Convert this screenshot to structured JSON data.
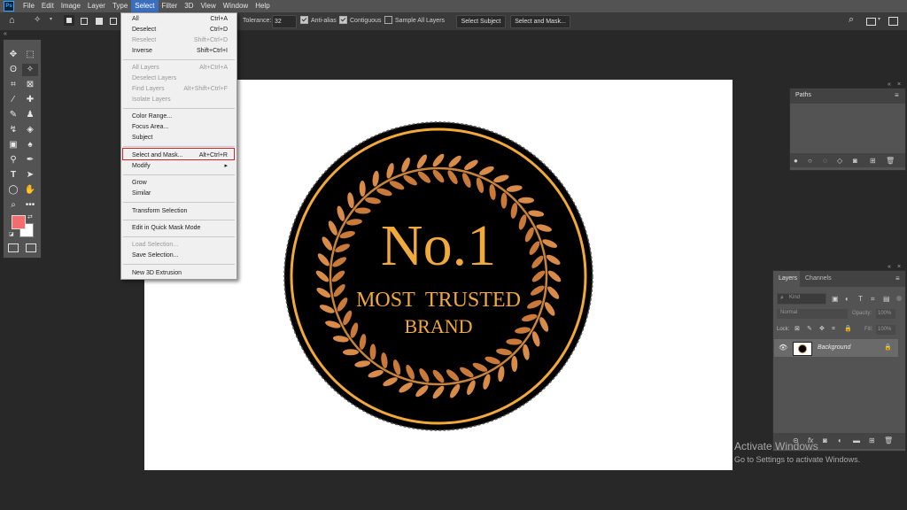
{
  "app": {
    "logo": "Ps"
  },
  "menubar": {
    "items": [
      "File",
      "Edit",
      "Image",
      "Layer",
      "Type",
      "Select",
      "Filter",
      "3D",
      "View",
      "Window",
      "Help"
    ],
    "active": "Select"
  },
  "options": {
    "tolerance_label": "Tolerance:",
    "tolerance_value": "32",
    "anti_alias": "Anti-alias",
    "contiguous": "Contiguous",
    "sample_all_layers": "Sample All Layers",
    "select_subject": "Select Subject",
    "select_and_mask": "Select and Mask..."
  },
  "select_menu": {
    "items": [
      {
        "label": "All",
        "shortcut": "Ctrl+A",
        "disabled": false
      },
      {
        "label": "Deselect",
        "shortcut": "Ctrl+D",
        "disabled": false
      },
      {
        "label": "Reselect",
        "shortcut": "Shift+Ctrl+D",
        "disabled": true
      },
      {
        "label": "Inverse",
        "shortcut": "Shift+Ctrl+I",
        "disabled": false
      },
      {
        "label": "All Layers",
        "shortcut": "Alt+Ctrl+A",
        "disabled": true
      },
      {
        "label": "Deselect Layers",
        "shortcut": "",
        "disabled": true
      },
      {
        "label": "Find Layers",
        "shortcut": "Alt+Shift+Ctrl+F",
        "disabled": true
      },
      {
        "label": "Isolate Layers",
        "shortcut": "",
        "disabled": true
      },
      {
        "label": "Color Range...",
        "shortcut": "",
        "disabled": false
      },
      {
        "label": "Focus Area...",
        "shortcut": "",
        "disabled": false
      },
      {
        "label": "Subject",
        "shortcut": "",
        "disabled": false
      },
      {
        "label": "Select and Mask...",
        "shortcut": "Alt+Ctrl+R",
        "disabled": false
      },
      {
        "label": "Modify",
        "shortcut": "▸",
        "disabled": false
      },
      {
        "label": "Grow",
        "shortcut": "",
        "disabled": false
      },
      {
        "label": "Similar",
        "shortcut": "",
        "disabled": false
      },
      {
        "label": "Transform Selection",
        "shortcut": "",
        "disabled": false
      },
      {
        "label": "Edit in Quick Mask Mode",
        "shortcut": "",
        "disabled": false
      },
      {
        "label": "Load Selection...",
        "shortcut": "",
        "disabled": true
      },
      {
        "label": "Save Selection...",
        "shortcut": "",
        "disabled": false
      },
      {
        "label": "New 3D Extrusion",
        "shortcut": "",
        "disabled": false
      }
    ]
  },
  "badge": {
    "headline": "No.1",
    "line1": "MOST  TRUSTED",
    "line2": "BRAND",
    "gold": "#f2a93b",
    "black": "#000000"
  },
  "paths_panel": {
    "title": "Paths"
  },
  "layers_panel": {
    "tabs": [
      "Layers",
      "Channels"
    ],
    "kind_label": "Kind",
    "blend_mode": "Normal",
    "opacity_label": "Opacity:",
    "opacity_value": "100%",
    "lock_label": "Lock:",
    "fill_label": "Fill:",
    "fill_value": "100%",
    "layer_name": "Background"
  },
  "watermark": {
    "title": "Activate Windows",
    "subtitle": "Go to Settings to activate Windows."
  },
  "colors": {
    "foreground": "#f26d6d",
    "background": "#ffffff",
    "menu_highlight": "#d0232b"
  }
}
